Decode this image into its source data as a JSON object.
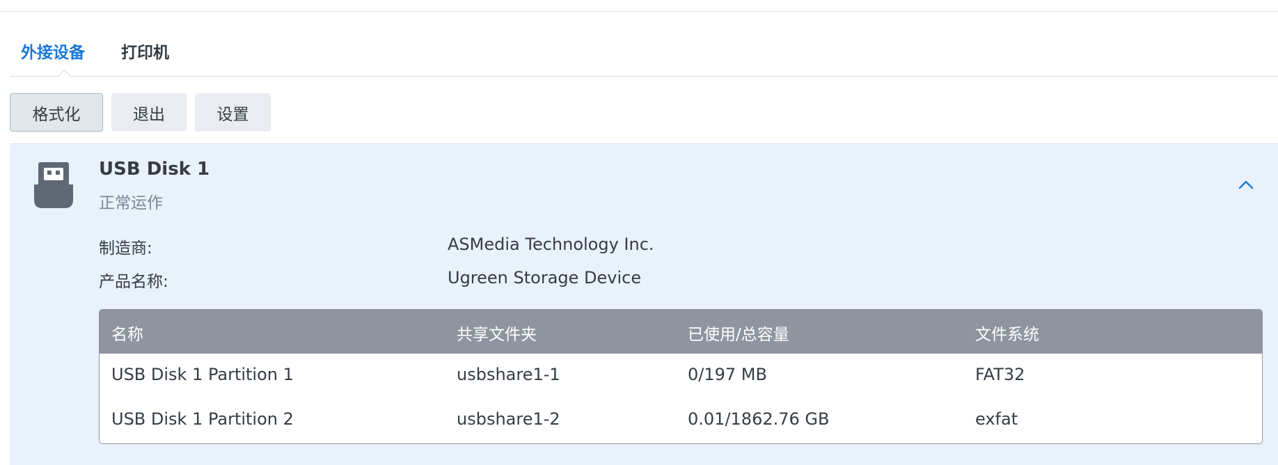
{
  "tabs": [
    {
      "label": "外接设备",
      "active": true
    },
    {
      "label": "打印机",
      "active": false
    }
  ],
  "toolbar": {
    "format_label": "格式化",
    "eject_label": "退出",
    "settings_label": "设置"
  },
  "device": {
    "icon": "usb-drive-icon",
    "name": "USB Disk 1",
    "status": "正常运作",
    "manufacturer_label": "制造商:",
    "manufacturer_value": "ASMedia Technology Inc.",
    "product_label": "产品名称:",
    "product_value": "Ugreen Storage Device"
  },
  "partitions": {
    "columns": [
      "名称",
      "共享文件夹",
      "已使用/总容量",
      "文件系统"
    ],
    "rows": [
      [
        "USB Disk 1 Partition 1",
        "usbshare1-1",
        "0/197 MB",
        "FAT32"
      ],
      [
        "USB Disk 1 Partition 2",
        "usbshare1-2",
        "0.01/1862.76 GB",
        "exfat"
      ]
    ]
  },
  "colors": {
    "accent": "#1a78d6",
    "panel_bg": "#e9f1fb",
    "table_header_bg": "#8e959f",
    "status_text": "#7d8793"
  }
}
